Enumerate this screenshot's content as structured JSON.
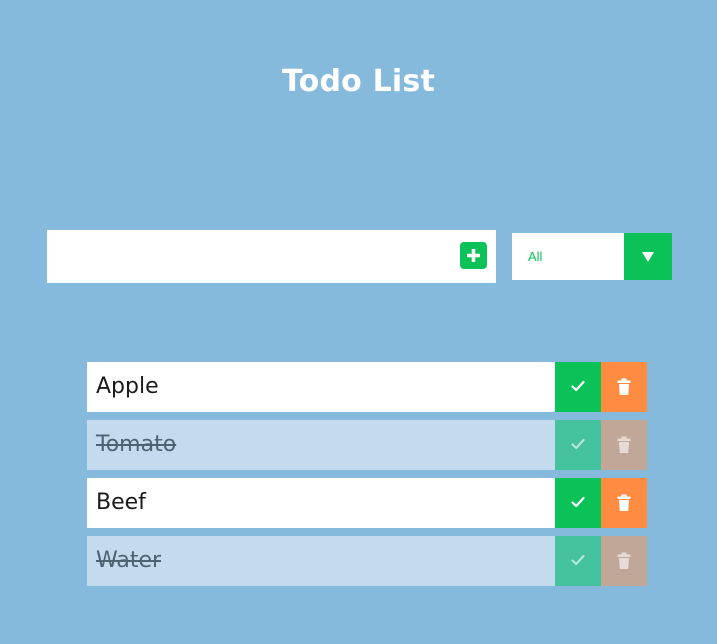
{
  "header": {
    "title": "Todo List"
  },
  "new_todo": {
    "value": "",
    "placeholder": "",
    "add_icon": "plus-icon"
  },
  "filter": {
    "selected": "All",
    "arrow_icon": "caret-down-icon"
  },
  "todos": [
    {
      "text": "Apple",
      "completed": false
    },
    {
      "text": "Tomato",
      "completed": true
    },
    {
      "text": "Beef",
      "completed": false
    },
    {
      "text": "Water",
      "completed": true
    }
  ],
  "colors": {
    "background": "#86badd",
    "accent_green": "#0bc258",
    "delete_orange": "#ff8c40",
    "completed_row": "#c4dbef"
  }
}
